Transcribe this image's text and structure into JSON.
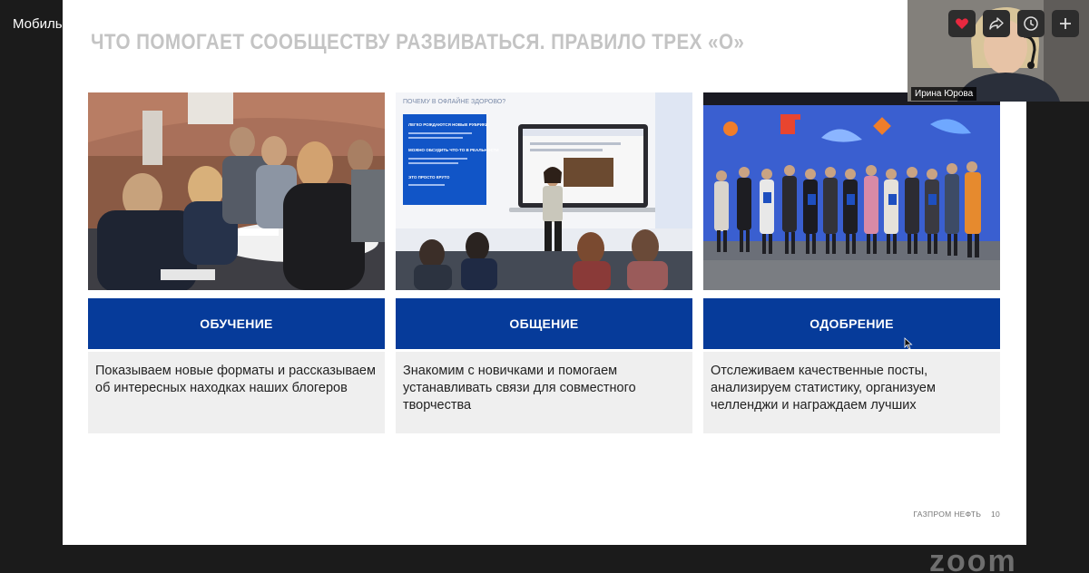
{
  "meeting": {
    "title": "Мобильная лента — новый «живой журнал»?"
  },
  "slide": {
    "heading": "ЧТО ПОМОГАЕТ СООБЩЕСТВУ РАЗВИВАТЬСЯ. ПРАВИЛО ТРЕХ «О»",
    "footer_brand": "ГАЗПРОМ НЕФТЬ",
    "page_number": "10",
    "columns": [
      {
        "title": "ОБУЧЕНИЕ",
        "text": "Показываем новые форматы и рассказываем об интересных находках наших блогеров"
      },
      {
        "title": "ОБЩЕНИЕ",
        "text": "Знакомим с новичками и помогаем устанавливать связи для совместного творчества"
      },
      {
        "title": "ОДОБРЕНИЕ",
        "text": "Отслеживаем качественные посты, анализируем статистику, организуем челленджи и награждаем лучших"
      }
    ],
    "presentation_photo": {
      "screen_heading": "ПОЧЕМУ В ОФЛАЙНЕ ЗДОРОВО?",
      "points": [
        "ЛЕГКО РОЖДАЮТСЯ НОВЫЕ РУБРИКИ",
        "МОЖНО ОБСУДИТЬ ЧТО-ТО В РЕАЛЬНОСТИ",
        "ЭТО ПРОСТО КРУТО"
      ]
    }
  },
  "participant": {
    "name": "Ирина Юрова"
  },
  "watermark": "zoom",
  "icons": {
    "heart": "heart-icon",
    "share": "share-icon",
    "clock": "clock-icon",
    "plus": "plus-icon"
  },
  "colors": {
    "banner": "#063b9a",
    "heart": "#e8283f"
  }
}
